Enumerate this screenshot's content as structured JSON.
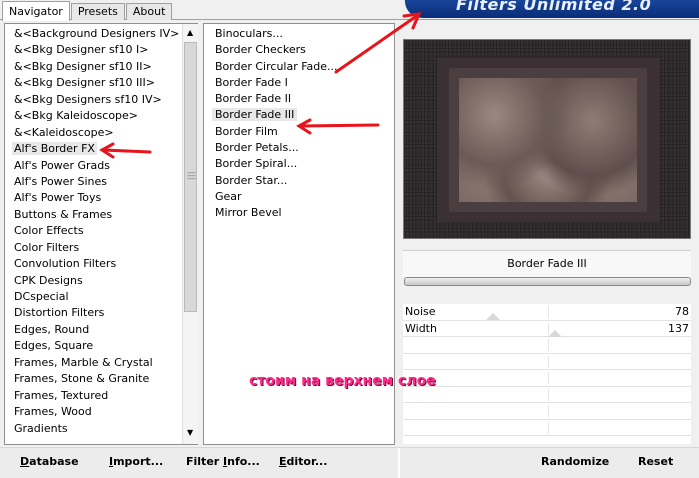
{
  "tabs": [
    {
      "label": "Navigator"
    },
    {
      "label": "Presets"
    },
    {
      "label": "About"
    }
  ],
  "banner": {
    "title": "Filters Unlimited 2.0"
  },
  "categories": [
    "&<Background Designers IV>",
    "&<Bkg Designer sf10 I>",
    "&<Bkg Designer sf10 II>",
    "&<Bkg Designer sf10 III>",
    "&<Bkg Designers sf10 IV>",
    "&<Bkg Kaleidoscope>",
    "&<Kaleidoscope>",
    "Alf's Border FX",
    "Alf's Power Grads",
    "Alf's Power Sines",
    "Alf's Power Toys",
    "Buttons & Frames",
    "Color Effects",
    "Color Filters",
    "Convolution Filters",
    "CPK Designs",
    "DCspecial",
    "Distortion Filters",
    "Edges, Round",
    "Edges, Square",
    "Frames, Marble & Crystal",
    "Frames, Stone & Granite",
    "Frames, Textured",
    "Frames, Wood",
    "Gradients"
  ],
  "selected_category": "Alf's Border FX",
  "effects": [
    "Binoculars...",
    "Border Checkers",
    "Border Circular Fade...",
    "Border Fade I",
    "Border Fade II",
    "Border Fade III",
    "Border Film",
    "Border Petals...",
    "Border Spiral...",
    "Border Star...",
    "Gear",
    "Mirror Bevel"
  ],
  "selected_effect": "Border Fade III",
  "current_filter": "Border Fade III",
  "parameters": [
    {
      "label": "Noise",
      "value": "78",
      "level": 78
    },
    {
      "label": "Width",
      "value": "137",
      "level": 137
    }
  ],
  "bottom_buttons": {
    "database_first": "D",
    "database_rest": "atabase",
    "import_first": "I",
    "import_rest": "mport...",
    "filterinfo_first": "Filter ",
    "filterinfo_under": "I",
    "filterinfo_rest": "nfo...",
    "editor_first": "E",
    "editor_rest": "ditor...",
    "randomize": "Randomize",
    "reset": "Reset"
  },
  "annotation": "стоим на верхнем слое",
  "colors": {
    "banner": "#1e4fa8",
    "arrow": "#e8141c",
    "annotation": "#ff2a8a"
  }
}
